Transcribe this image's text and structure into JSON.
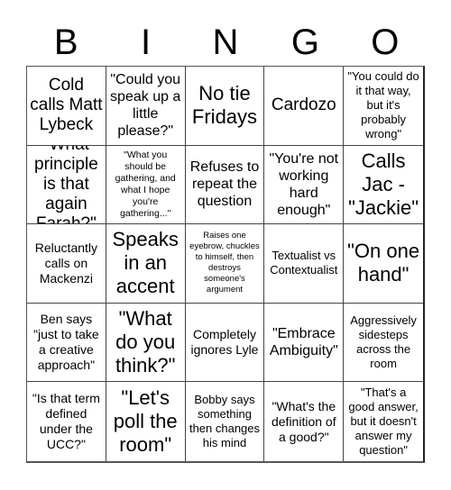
{
  "header": {
    "letters": [
      "B",
      "I",
      "N",
      "G",
      "O"
    ]
  },
  "board": {
    "cells": [
      "Cold calls Matt Lybeck",
      "\"Could you speak up a little please?\"",
      "No tie Fridays",
      "Cardozo",
      "\"You could do it that way, but it's probably wrong\"",
      "\"What principle is that again Farah?\"",
      "\"What you should be gathering, and what I hope you're gathering...\"",
      "Refuses to repeat the question",
      "\"You're not working hard enough\"",
      "Calls Jac - \"Jackie\"",
      "Reluctantly calls on Mackenzi",
      "Speaks in an accent",
      "Raises one eyebrow, chuckles to himself, then destroys someone's argument",
      "Textualist vs Contextualist",
      "\"On one hand\"",
      "Ben says \"just to take a creative approach\"",
      "\"What do you think?\"",
      "Completely ignores Lyle",
      "\"Embrace Ambiguity\"",
      "Aggressively sidesteps across the room",
      "\"Is that term defined under the UCC?\"",
      "\"Let's poll the room\"",
      "Bobby says something then changes his mind",
      "\"What's the definition of a good?\"",
      "\"That's a good answer, but it doesn't answer my question\""
    ]
  }
}
